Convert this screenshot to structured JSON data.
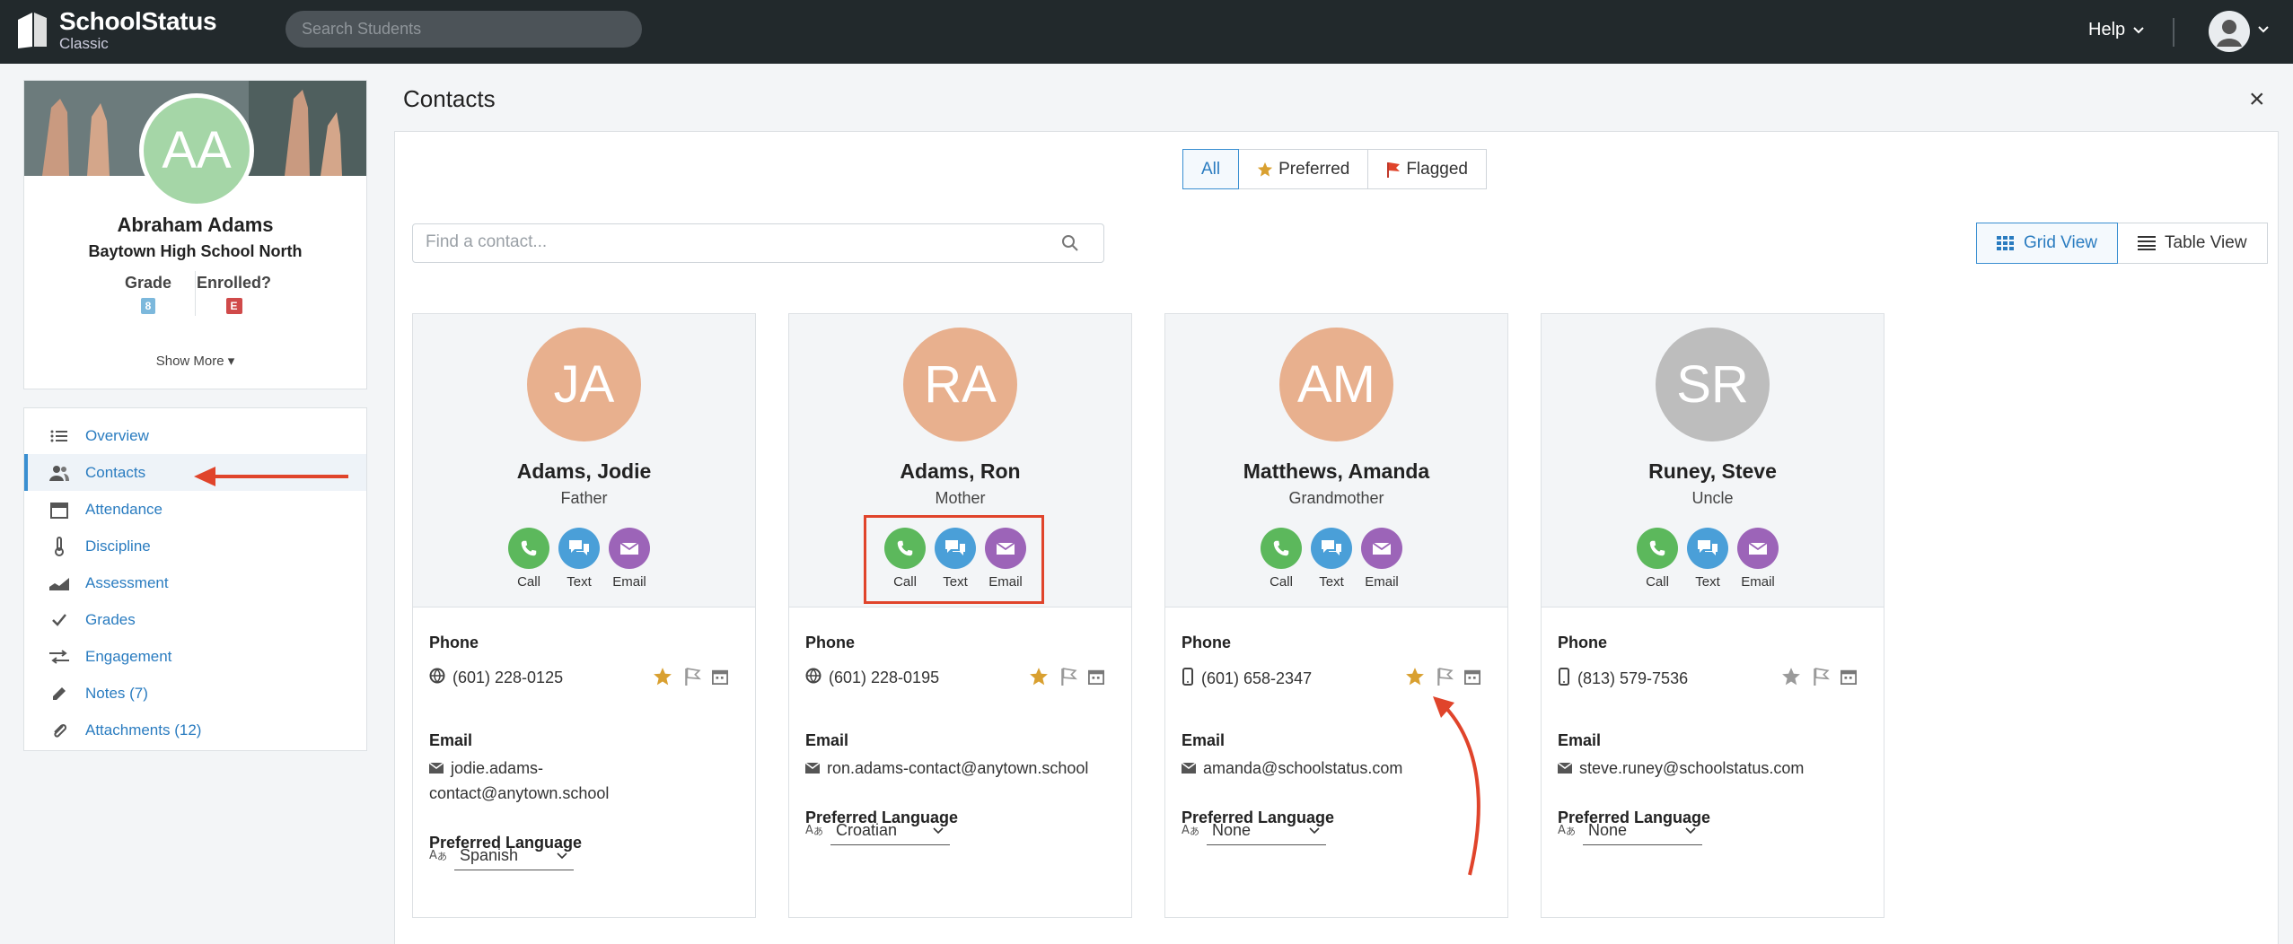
{
  "app": {
    "title": "SchoolStatus",
    "subtitle": "Classic"
  },
  "header": {
    "search_placeholder": "Search Students",
    "help_label": "Help"
  },
  "student": {
    "initials": "AA",
    "name": "Abraham Adams",
    "school": "Baytown High School North",
    "grade_label": "Grade",
    "grade_value": "8",
    "enrolled_label": "Enrolled?",
    "enrolled_value": "E",
    "show_more": "Show More ▾"
  },
  "nav": {
    "items": [
      {
        "label": "Overview",
        "icon": "list-icon"
      },
      {
        "label": "Contacts",
        "icon": "users-icon"
      },
      {
        "label": "Attendance",
        "icon": "calendar-icon"
      },
      {
        "label": "Discipline",
        "icon": "thermometer-icon"
      },
      {
        "label": "Assessment",
        "icon": "chart-icon"
      },
      {
        "label": "Grades",
        "icon": "check-icon"
      },
      {
        "label": "Engagement",
        "icon": "arrows-icon"
      },
      {
        "label": "Notes (7)",
        "icon": "pencil-icon"
      },
      {
        "label": "Attachments (12)",
        "icon": "paperclip-icon"
      }
    ]
  },
  "main": {
    "title": "Contacts",
    "close": "×",
    "filters": {
      "all": "All",
      "preferred": "Preferred",
      "flagged": "Flagged"
    },
    "search_placeholder": "Find a contact...",
    "views": {
      "grid": "Grid View",
      "table": "Table View"
    },
    "action_labels": {
      "call": "Call",
      "text": "Text",
      "email": "Email"
    },
    "section_labels": {
      "phone": "Phone",
      "email": "Email",
      "language": "Preferred Language"
    }
  },
  "contacts": [
    {
      "initials": "JA",
      "name": "Adams, Jodie",
      "relation": "Father",
      "phone": "(601) 228-0125",
      "phone_type": "landline",
      "preferred": true,
      "email_line1": "jodie.adams-",
      "email_line2": "contact@anytown.school",
      "language": "Spanish",
      "avatar_color": "#e8b08e"
    },
    {
      "initials": "RA",
      "name": "Adams, Ron",
      "relation": "Mother",
      "phone": "(601) 228-0195",
      "phone_type": "landline",
      "preferred": true,
      "email_line1": "ron.adams-contact@anytown.school",
      "email_line2": "",
      "language": "Croatian",
      "avatar_color": "#e8b08e"
    },
    {
      "initials": "AM",
      "name": "Matthews, Amanda",
      "relation": "Grandmother",
      "phone": "(601) 658-2347",
      "phone_type": "mobile",
      "preferred": true,
      "email_line1": "amanda@schoolstatus.com",
      "email_line2": "",
      "language": "None",
      "avatar_color": "#e8b08e"
    },
    {
      "initials": "SR",
      "name": "Runey, Steve",
      "relation": "Uncle",
      "phone": "(813) 579-7536",
      "phone_type": "mobile",
      "preferred": false,
      "email_line1": "steve.runey@schoolstatus.com",
      "email_line2": "",
      "language": "None",
      "avatar_color": "#bdbdbd"
    }
  ],
  "colors": {
    "call": "#5cb85c",
    "text": "#4a9fd8",
    "email": "#9c64b8",
    "star_on": "#d9a030",
    "star_off": "#9a9a9a",
    "annotation": "#e0442b",
    "link": "#2a7cc0"
  }
}
